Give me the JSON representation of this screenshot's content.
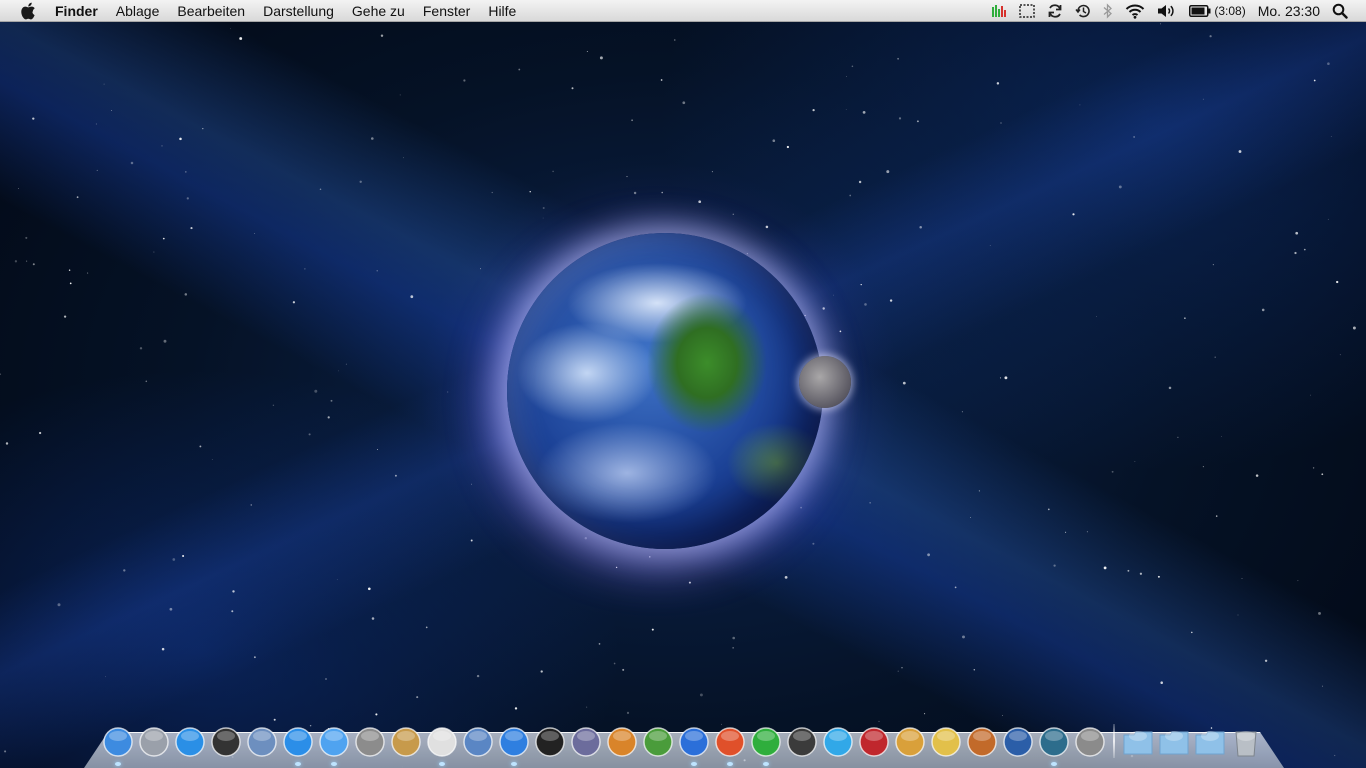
{
  "menubar": {
    "app_name": "Finder",
    "menus": [
      "Ablage",
      "Bearbeiten",
      "Darstellung",
      "Gehe zu",
      "Fenster",
      "Hilfe"
    ],
    "battery_time": "(3:08)",
    "clock": "Mo. 23:30"
  },
  "status_icons": [
    "activity-monitor-icon",
    "screen-capture-icon",
    "sync-icon",
    "time-machine-icon",
    "bluetooth-icon",
    "wifi-icon",
    "volume-icon",
    "battery-icon",
    "spotlight-icon"
  ],
  "dock": {
    "apps": [
      {
        "name": "finder",
        "color": "#3d8be0"
      },
      {
        "name": "launchpad",
        "color": "#9aa0aa"
      },
      {
        "name": "app-store",
        "color": "#2a8fe6"
      },
      {
        "name": "dashboard",
        "color": "#333333"
      },
      {
        "name": "mail",
        "color": "#6d8fbf"
      },
      {
        "name": "safari",
        "color": "#2b8ee8"
      },
      {
        "name": "ichat",
        "color": "#4fa3f0"
      },
      {
        "name": "facetime",
        "color": "#8c8c8c"
      },
      {
        "name": "address-book",
        "color": "#c79a4b"
      },
      {
        "name": "ical",
        "color": "#e0e0e0"
      },
      {
        "name": "iphoto",
        "color": "#5a86c4"
      },
      {
        "name": "itunes",
        "color": "#2f7fe0"
      },
      {
        "name": "camera",
        "color": "#222222"
      },
      {
        "name": "keynote-tool",
        "color": "#6c6c9c"
      },
      {
        "name": "keynote",
        "color": "#d9842a"
      },
      {
        "name": "numbers",
        "color": "#4a9c3b"
      },
      {
        "name": "word",
        "color": "#2b6fd9"
      },
      {
        "name": "powerpoint",
        "color": "#e0502a"
      },
      {
        "name": "excel",
        "color": "#2fae3c"
      },
      {
        "name": "aperture",
        "color": "#3b3b3b"
      },
      {
        "name": "photoshop-elements",
        "color": "#31a8e8"
      },
      {
        "name": "photo-booth",
        "color": "#c0272d"
      },
      {
        "name": "image-capture",
        "color": "#d9a03a"
      },
      {
        "name": "imovie",
        "color": "#e2c04a"
      },
      {
        "name": "garageband",
        "color": "#c26a2a"
      },
      {
        "name": "world-of-warcraft",
        "color": "#2b5ea8"
      },
      {
        "name": "time-machine",
        "color": "#2d6d8c"
      },
      {
        "name": "system-preferences",
        "color": "#8b8b8b"
      }
    ],
    "folders": [
      {
        "name": "applications-folder",
        "color": "#8fc1e8"
      },
      {
        "name": "documents-folder",
        "color": "#8fc1e8"
      },
      {
        "name": "downloads-folder",
        "color": "#8fc1e8"
      }
    ],
    "trash": {
      "name": "trash",
      "color": "#b9bfc6"
    }
  }
}
